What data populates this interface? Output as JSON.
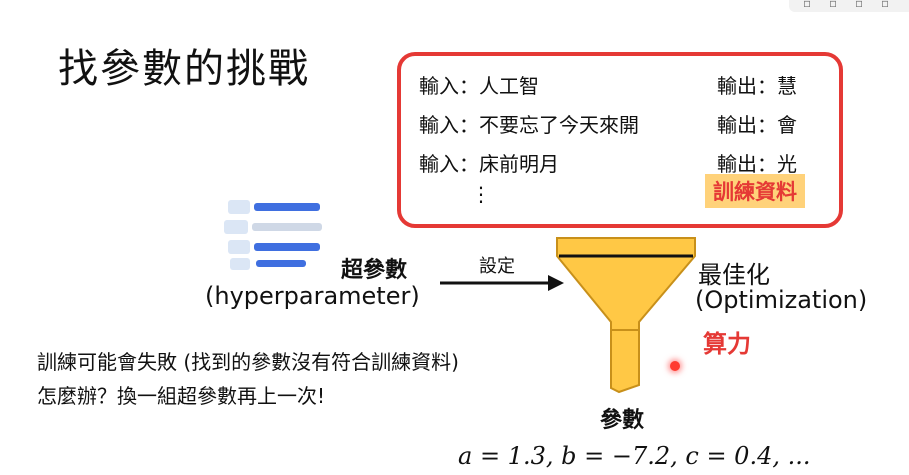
{
  "title": "找參數的挑戰",
  "training_box": {
    "rows": [
      {
        "input": "輸入：人工智",
        "output": "輸出：慧"
      },
      {
        "input": "輸入：不要忘了今天來開",
        "output": "輸出：會"
      },
      {
        "input": "輸入：床前明月",
        "output": "輸出：光"
      }
    ],
    "ellipsis": "⋮",
    "label": "訓練資料",
    "border_color": "#e53935",
    "label_bg": "#ffd27a"
  },
  "hyper": {
    "label": "超參數",
    "sub": "(hyperparameter)",
    "arrow_label": "設定",
    "icon": "list-lines-icon"
  },
  "optimization": {
    "line1": "最佳化",
    "line2": "(Optimization)",
    "compute": "算力",
    "icon": "funnel-icon",
    "funnel_color": "#ffc845"
  },
  "failure": {
    "line1": "訓練可能會失敗 (找到的參數沒有符合訓練資料)",
    "line2": "怎麼辦？換一組超參數再上一次!"
  },
  "params": {
    "label": "參數",
    "values": "a = 1.3, b = −7.2, c = 0.4, ..."
  }
}
